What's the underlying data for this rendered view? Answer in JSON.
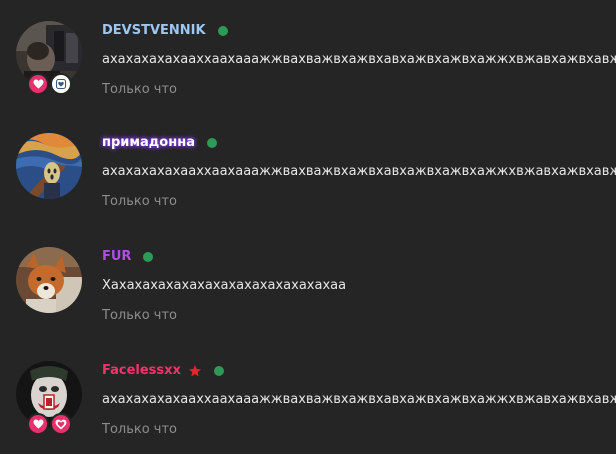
{
  "comments": [
    {
      "username": "DEVSTVENNIK",
      "username_color": "#9dc6f0",
      "message": "ахахахахахааххаахааажжвахважвхажвхавхажвхажвхажжхвжавхажвхавж",
      "time": "Только что",
      "online": true,
      "badges": [
        "heart-badge",
        "shield-badge"
      ]
    },
    {
      "username": "примадонна",
      "username_color": "#ffffff",
      "username_glow": "#8a3cff",
      "message": "ахахахахахааххаахааажжвахважвхажвхавхажвхажвхажжхвжавхажвхавж",
      "time": "Только что",
      "online": true,
      "badges": []
    },
    {
      "username": "FUR",
      "username_color": "#b04ee0",
      "message": "Хахахахахахахахахахахахахахахаа",
      "time": "Только что",
      "online": true,
      "badges": []
    },
    {
      "username": "Facelessxx",
      "username_color": "#ff2f6e",
      "message": "ахахахахахааххаахааажжвахважвхажвхавхажвхажвхажжхвжавхажвхавж",
      "time": "Только что",
      "online": true,
      "has_star": true,
      "badges": [
        "heart-badge",
        "white-heart-badge"
      ]
    }
  ],
  "colors": {
    "background": "#252525",
    "online": "#2e9a57",
    "message": "#e6e6e6",
    "time": "#8d8d8d",
    "star": "#e8232e"
  }
}
